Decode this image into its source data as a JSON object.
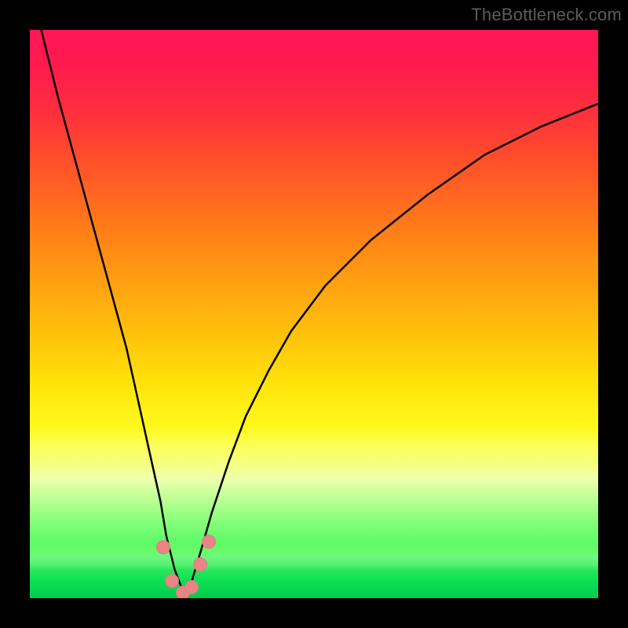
{
  "attribution": "TheBottleneck.com",
  "chart_data": {
    "type": "line",
    "title": "",
    "xlabel": "",
    "ylabel": "",
    "xlim": [
      0,
      100
    ],
    "ylim": [
      0,
      100
    ],
    "series": [
      {
        "name": "bottleneck-curve",
        "description": "V-shaped bottleneck curve; minimum near x≈27 at y≈0; rises steeply toward y≈100 at the extremes",
        "x": [
          2,
          5,
          8,
          11,
          14,
          17,
          19,
          21,
          23,
          24,
          25.5,
          27,
          28.5,
          30,
          32,
          35,
          38,
          42,
          46,
          52,
          60,
          70,
          80,
          90,
          100
        ],
        "values": [
          100,
          88,
          77,
          66,
          55,
          44,
          35,
          26,
          17,
          11,
          5,
          1,
          3,
          8,
          15,
          24,
          32,
          40,
          47,
          55,
          63,
          71,
          78,
          83,
          87
        ]
      }
    ],
    "markers": {
      "name": "valley-highlight",
      "color": "#e98484",
      "points": [
        {
          "x": 23.5,
          "y": 9
        },
        {
          "x": 25.0,
          "y": 3
        },
        {
          "x": 27.0,
          "y": 1
        },
        {
          "x": 28.5,
          "y": 2
        },
        {
          "x": 30.0,
          "y": 6
        },
        {
          "x": 31.5,
          "y": 10
        }
      ]
    },
    "background_gradient": {
      "top": "#ff1755",
      "mid": "#ffd400",
      "bottom": "#00cc4e"
    }
  }
}
